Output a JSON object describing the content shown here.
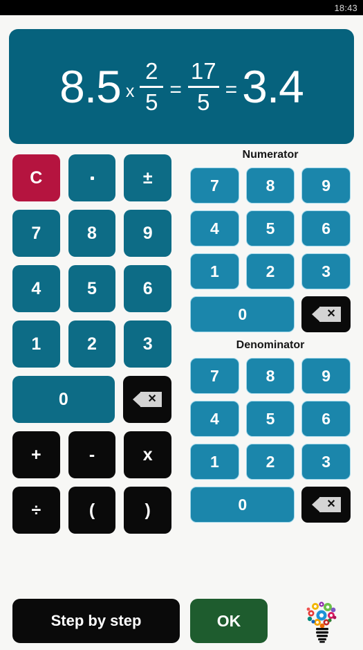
{
  "status_bar": {
    "time": "18:43"
  },
  "display": {
    "operand_left": "8.5",
    "operator": "x",
    "fraction_input": {
      "numerator": "2",
      "denominator": "5"
    },
    "equals_1": "=",
    "fraction_result": {
      "numerator": "17",
      "denominator": "5"
    },
    "equals_2": "=",
    "decimal_result": "3.4",
    "expression": "8.5 x 2/5 = 17/5 = 3.4",
    "background_color": "#06627d"
  },
  "main_keypad": {
    "rows": [
      [
        {
          "label": "C",
          "name": "clear-key",
          "style": "crimson"
        },
        {
          "label": ".",
          "name": "decimal-point-key",
          "style": "teal-dark"
        },
        {
          "label": "±",
          "name": "sign-toggle-key",
          "style": "teal-dark"
        }
      ],
      [
        {
          "label": "7",
          "name": "digit-7-key",
          "style": "teal-dark"
        },
        {
          "label": "8",
          "name": "digit-8-key",
          "style": "teal-dark"
        },
        {
          "label": "9",
          "name": "digit-9-key",
          "style": "teal-dark"
        }
      ],
      [
        {
          "label": "4",
          "name": "digit-4-key",
          "style": "teal-dark"
        },
        {
          "label": "5",
          "name": "digit-5-key",
          "style": "teal-dark"
        },
        {
          "label": "6",
          "name": "digit-6-key",
          "style": "teal-dark"
        }
      ],
      [
        {
          "label": "1",
          "name": "digit-1-key",
          "style": "teal-dark"
        },
        {
          "label": "2",
          "name": "digit-2-key",
          "style": "teal-dark"
        },
        {
          "label": "3",
          "name": "digit-3-key",
          "style": "teal-dark"
        }
      ]
    ],
    "zero_label": "0",
    "backspace_icon": "backspace-icon",
    "operators_row_1": [
      {
        "label": "+",
        "name": "add-key"
      },
      {
        "label": "-",
        "name": "subtract-key"
      },
      {
        "label": "x",
        "name": "multiply-key"
      }
    ],
    "operators_row_2": [
      {
        "label": "÷",
        "name": "divide-key"
      },
      {
        "label": "(",
        "name": "open-paren-key"
      },
      {
        "label": ")",
        "name": "close-paren-key"
      }
    ],
    "colors": {
      "digit": "#0d6c86",
      "clear": "#b5143f",
      "operator": "#0a0a0a"
    }
  },
  "numerator_pad": {
    "label": "Numerator",
    "rows": [
      [
        "7",
        "8",
        "9"
      ],
      [
        "4",
        "5",
        "6"
      ],
      [
        "1",
        "2",
        "3"
      ]
    ],
    "zero_label": "0",
    "backspace_icon": "backspace-icon",
    "color": "#1b86ab"
  },
  "denominator_pad": {
    "label": "Denominator",
    "rows": [
      [
        "7",
        "8",
        "9"
      ],
      [
        "4",
        "5",
        "6"
      ],
      [
        "1",
        "2",
        "3"
      ]
    ],
    "zero_label": "0",
    "backspace_icon": "backspace-icon",
    "color": "#1b86ab"
  },
  "bottom_bar": {
    "step_by_step_label": "Step by step",
    "ok_label": "OK",
    "hint_icon": "lightbulb-icon",
    "ok_color": "#1e5c2e"
  }
}
